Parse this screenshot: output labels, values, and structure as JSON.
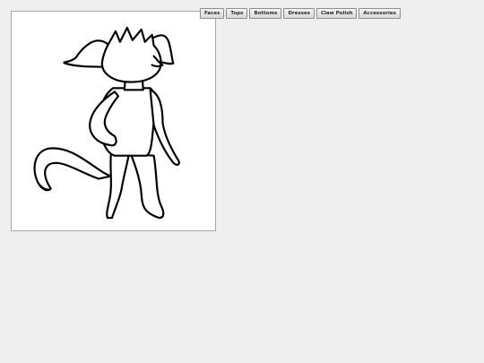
{
  "menu": {
    "tabs": [
      {
        "label": "Faces"
      },
      {
        "label": "Tops"
      },
      {
        "label": "Bottoms"
      },
      {
        "label": "Dresses"
      },
      {
        "label": "Claw Polish"
      },
      {
        "label": "Accessories"
      }
    ]
  },
  "colors": {
    "page_background": "#efefef",
    "canvas_background": "#ffffff",
    "line_art": "#000000"
  }
}
